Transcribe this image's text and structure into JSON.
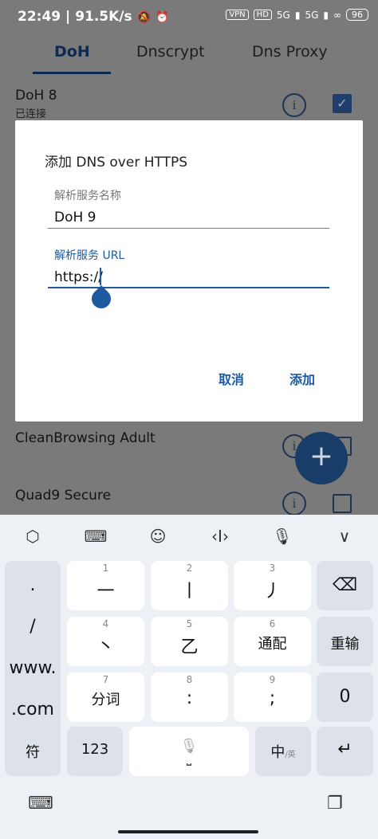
{
  "status_bar": {
    "time": "22:49",
    "speed": "91.5K/s",
    "vpn": "VPN",
    "hd": "HD",
    "net1": "5G",
    "net2": "5G",
    "battery": "96"
  },
  "tabs": [
    {
      "label": "DoH"
    },
    {
      "label": "Dnscrypt"
    },
    {
      "label": "Dns Proxy"
    }
  ],
  "list": {
    "item1": {
      "name": "DoH 8",
      "status": "已连接",
      "checked": true
    },
    "item2": {
      "name": "CleanBrowsing Adult"
    },
    "item3": {
      "name": "Quad9 Secure"
    }
  },
  "dialog": {
    "title": "添加 DNS over HTTPS",
    "name_label": "解析服务名称",
    "name_value": "DoH 9",
    "url_label": "解析服务 URL",
    "url_value": "https://",
    "cancel": "取消",
    "add": "添加"
  },
  "keyboard": {
    "left_col": [
      ".",
      "/",
      "www.",
      ".com"
    ],
    "keys": [
      {
        "num": "1",
        "main": "一"
      },
      {
        "num": "2",
        "main": "丨"
      },
      {
        "num": "3",
        "main": "丿"
      },
      {
        "num": "4",
        "main": "丶"
      },
      {
        "num": "5",
        "main": "乙"
      },
      {
        "num": "6",
        "main": "通配"
      },
      {
        "num": "7",
        "main": "分词"
      },
      {
        "num": "8",
        "main": ":"
      },
      {
        "num": "9",
        "main": ";"
      }
    ],
    "reenter": "重输",
    "zero": "0",
    "symbols": "符",
    "numbers": "123",
    "lang_main": "中",
    "lang_alt": "/英"
  }
}
